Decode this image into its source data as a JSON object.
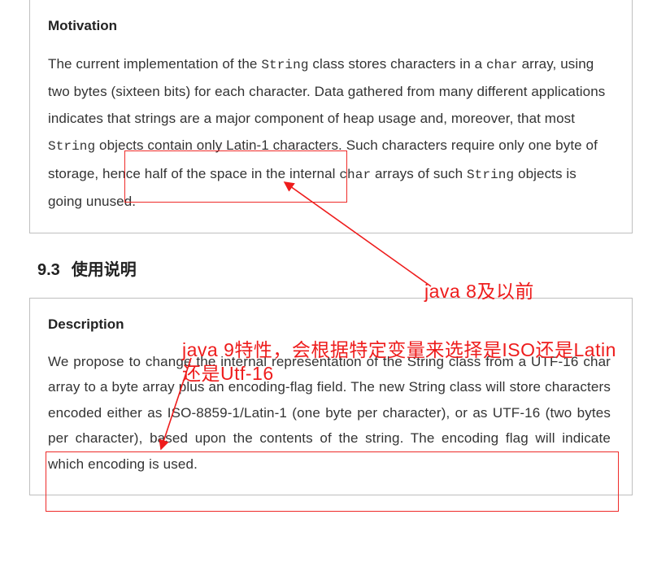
{
  "motivation": {
    "heading": "Motivation",
    "text_before_code1": "The current implementation of the ",
    "code1": "String",
    "text_after_code1": " class stores characters in a ",
    "code2": "char",
    "text_after_code2": " array, using two bytes (sixteen bits) for each character. Data gathered from many different applications indicates that strings are a major component of heap usage and, moreover, that most ",
    "code3": "String",
    "text_after_code3": " objects contain only Latin-1 characters. Such characters require only one byte of storage, hence half of the space in the internal ",
    "code4": "char",
    "text_after_code4": " arrays of such ",
    "code5": "String",
    "text_after_code5": " objects is going unused."
  },
  "chapter": {
    "num": "9.3",
    "title": "使用说明"
  },
  "description": {
    "heading": "Description",
    "text": "We propose to change the internal representation of the  String class from a UTF-16  char   array to a   byte   array plus an encoding-flag field. The new   String   class will store characters encoded either as ISO-8859-1/Latin-1 (one byte per character), or as UTF-16 (two bytes per character), based upon the contents of the string. The encoding flag will indicate which encoding is used."
  },
  "annotations": {
    "a1": "java 8及以前",
    "a2": "java 9特性，会根据特定变量来选择是ISO还是Latin还是Utf-16"
  }
}
